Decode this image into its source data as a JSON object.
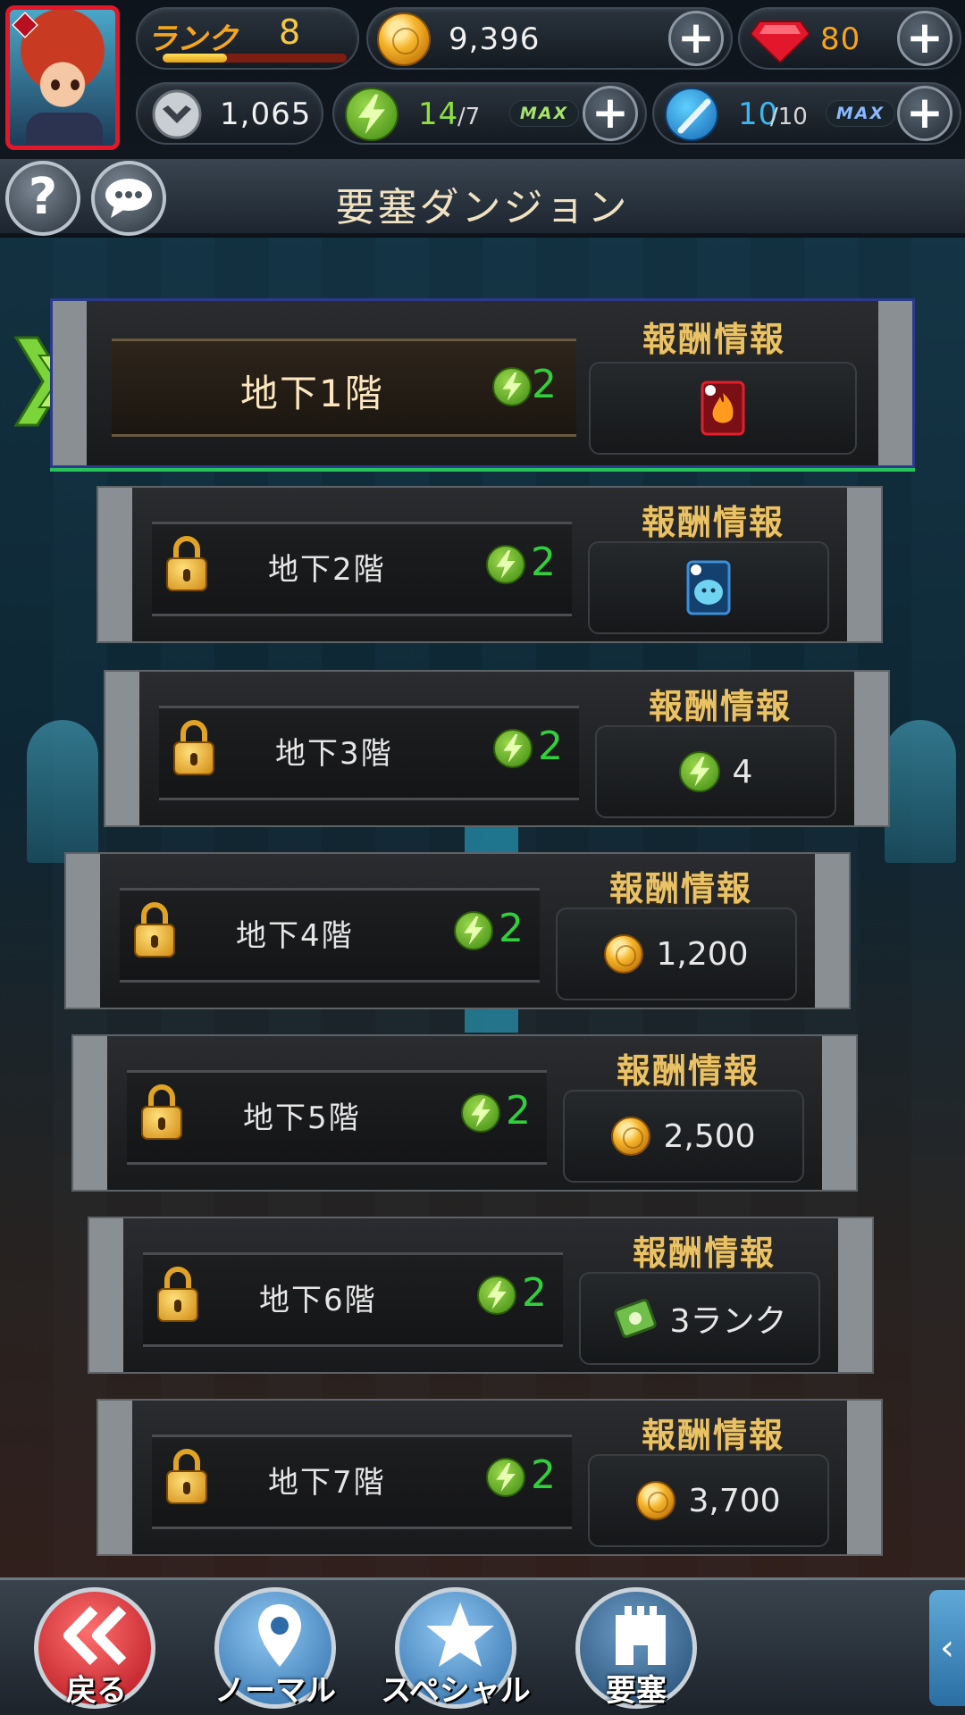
{
  "hud": {
    "rank_label": "ランク",
    "rank_value": "8",
    "rank_progress": 0.35,
    "coins": "9,396",
    "gems": "80",
    "medals": "1,065",
    "stamina_current": "14",
    "stamina_max": "/7",
    "stamina_max_badge": "MAX",
    "blue_current": "10",
    "blue_max": "/10",
    "blue_max_badge": "MAX"
  },
  "titlebar": {
    "title": "要塞ダンジョン",
    "help_label": "?"
  },
  "reward_heading": "報酬情報",
  "floors": [
    {
      "name": "地下1階",
      "cost": "2",
      "locked": false,
      "reward_icon": "fire-card-icon",
      "reward_text": ""
    },
    {
      "name": "地下2階",
      "cost": "2",
      "locked": true,
      "reward_icon": "water-card-icon",
      "reward_text": ""
    },
    {
      "name": "地下3階",
      "cost": "2",
      "locked": true,
      "reward_icon": "stamina-icon",
      "reward_text": "4"
    },
    {
      "name": "地下4階",
      "cost": "2",
      "locked": true,
      "reward_icon": "coin-icon",
      "reward_text": "1,200"
    },
    {
      "name": "地下5階",
      "cost": "2",
      "locked": true,
      "reward_icon": "coin-icon",
      "reward_text": "2,500"
    },
    {
      "name": "地下6階",
      "cost": "2",
      "locked": true,
      "reward_icon": "ticket-icon",
      "reward_text": "3ランク"
    },
    {
      "name": "地下7階",
      "cost": "2",
      "locked": true,
      "reward_icon": "coin-icon",
      "reward_text": "3,700"
    }
  ],
  "nav": {
    "back": "戻る",
    "normal": "ノーマル",
    "special": "スペシャル",
    "fortress": "要塞"
  },
  "colors": {
    "accent_red": "#e0182a",
    "stamina_green": "#31cf3c",
    "reward_gold": "#e9c266",
    "blue_text": "#3db6f0"
  }
}
